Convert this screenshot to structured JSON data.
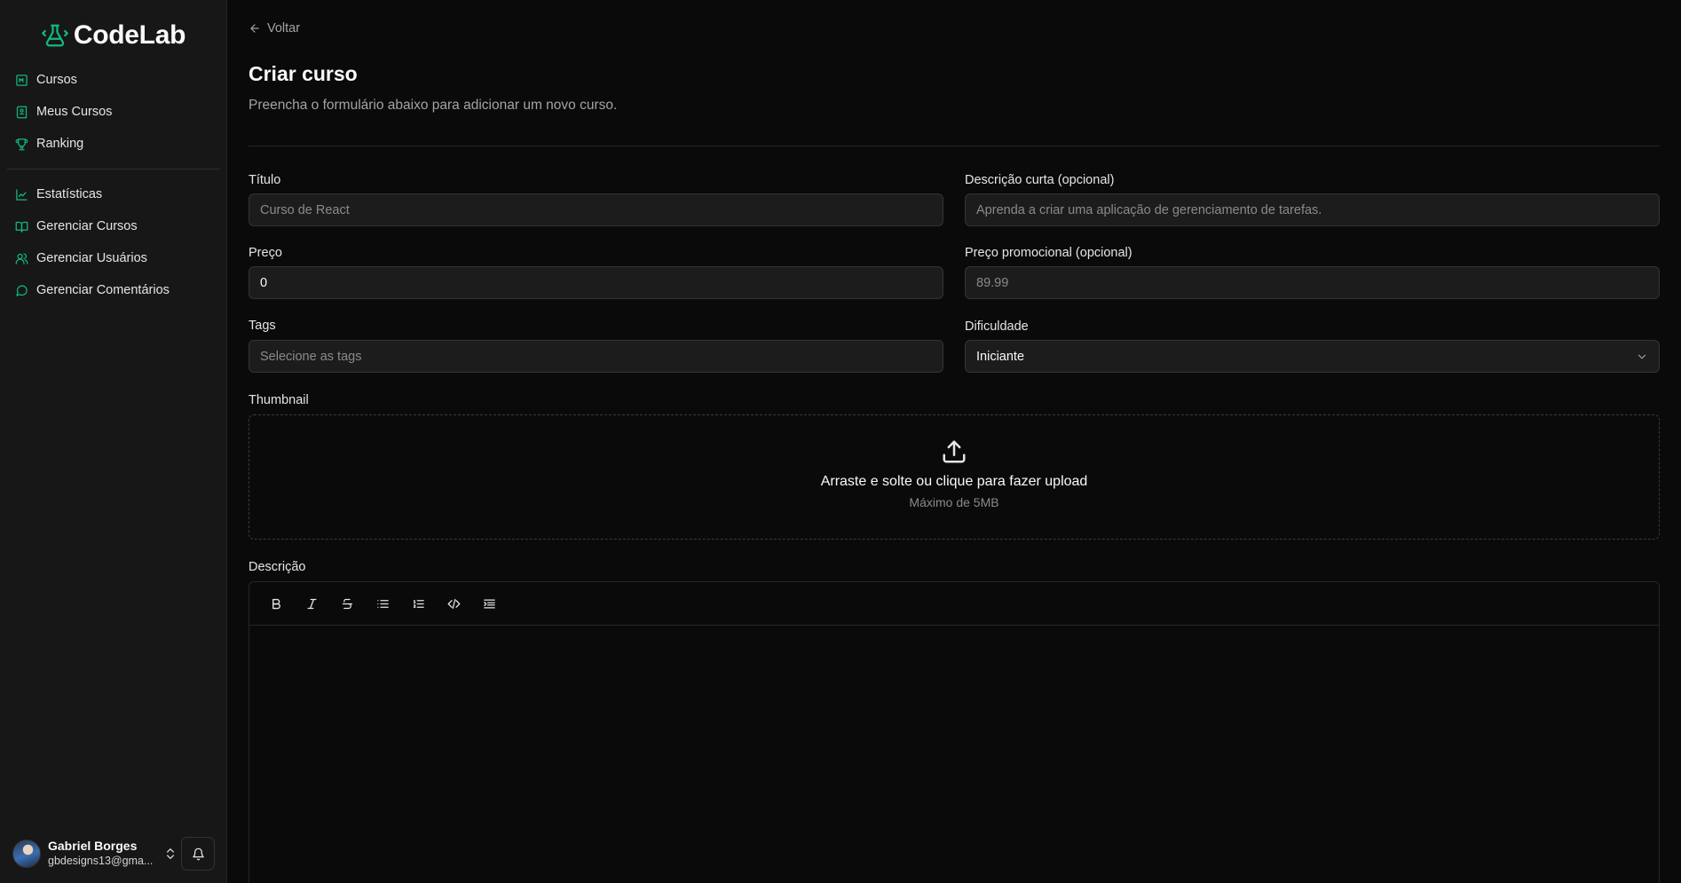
{
  "brand": {
    "name": "CodeLab",
    "accent": "#10b981"
  },
  "sidebar": {
    "primary": [
      {
        "label": "Cursos",
        "icon": "courses-icon"
      },
      {
        "label": "Meus Cursos",
        "icon": "my-courses-icon"
      },
      {
        "label": "Ranking",
        "icon": "trophy-icon"
      }
    ],
    "admin": [
      {
        "label": "Estatísticas",
        "icon": "chart-icon"
      },
      {
        "label": "Gerenciar Cursos",
        "icon": "book-open-icon"
      },
      {
        "label": "Gerenciar Usuários",
        "icon": "users-icon"
      },
      {
        "label": "Gerenciar Comentários",
        "icon": "message-circle-icon"
      }
    ],
    "user": {
      "name": "Gabriel Borges",
      "email": "gbdesigns13@gma..."
    }
  },
  "header": {
    "back_label": "Voltar",
    "title": "Criar curso",
    "subtitle": "Preencha o formulário abaixo para adicionar um novo curso."
  },
  "form": {
    "title": {
      "label": "Título",
      "placeholder": "Curso de React",
      "value": ""
    },
    "short_description": {
      "label": "Descrição curta (opcional)",
      "placeholder": "Aprenda a criar uma aplicação de gerenciamento de tarefas.",
      "value": ""
    },
    "price": {
      "label": "Preço",
      "value": "0"
    },
    "promo_price": {
      "label": "Preço promocional (opcional)",
      "placeholder": "89.99",
      "value": ""
    },
    "tags": {
      "label": "Tags",
      "placeholder": "Selecione as tags"
    },
    "difficulty": {
      "label": "Dificuldade",
      "value": "Iniciante"
    },
    "thumbnail": {
      "label": "Thumbnail",
      "upload_text": "Arraste e solte ou clique para fazer upload",
      "upload_hint": "Máximo de 5MB"
    },
    "description": {
      "label": "Descrição",
      "toolbar": [
        "bold-icon",
        "italic-icon",
        "strikethrough-icon",
        "bullet-list-icon",
        "ordered-list-icon",
        "code-icon",
        "indent-icon"
      ]
    }
  }
}
